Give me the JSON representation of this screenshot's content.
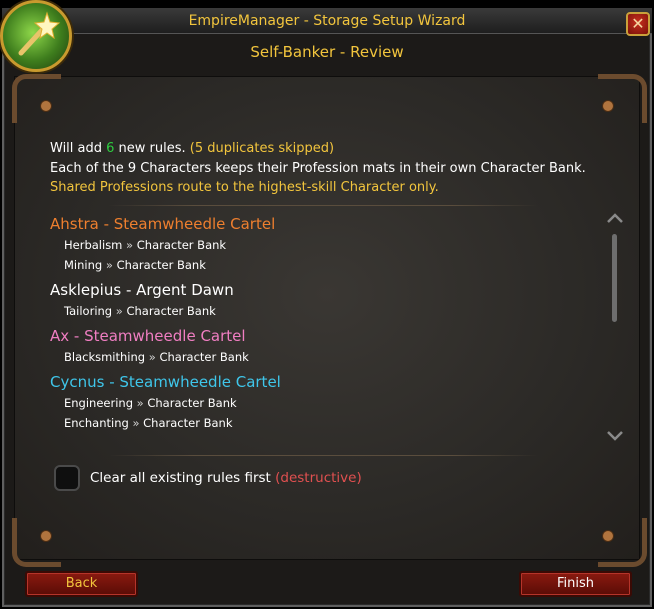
{
  "window": {
    "title": "EmpireManager - Storage Setup Wizard",
    "subtitle": "Self-Banker - Review",
    "close_glyph": "✕"
  },
  "summary": {
    "line1_prefix": "Will add ",
    "count": "6",
    "line1_mid": " new rules. ",
    "duplicates": "(5 duplicates skipped)",
    "line2": "Each of the 9 Characters keeps their Profession mats in their own Character Bank.",
    "line3": "Shared Professions route to the highest-skill Character only."
  },
  "characters": [
    {
      "name": "Ahstra - Steamwheedle Cartel",
      "color": "#ee7f2e",
      "rules": [
        {
          "prof": "Herbalism",
          "dest": "Character Bank"
        },
        {
          "prof": "Mining",
          "dest": "Character Bank"
        }
      ]
    },
    {
      "name": "Asklepius - Argent Dawn",
      "color": "#ffffff",
      "rules": [
        {
          "prof": "Tailoring",
          "dest": "Character Bank"
        }
      ]
    },
    {
      "name": "Ax - Steamwheedle Cartel",
      "color": "#f07ec2",
      "rules": [
        {
          "prof": "Blacksmithing",
          "dest": "Character Bank"
        }
      ]
    },
    {
      "name": "Cycnus - Steamwheedle Cartel",
      "color": "#3fc6ea",
      "rules": [
        {
          "prof": "Engineering",
          "dest": "Character Bank"
        },
        {
          "prof": "Enchanting",
          "dest": "Character Bank"
        }
      ]
    }
  ],
  "rule_separator": "»",
  "options": {
    "clear_label": "Clear all existing rules first ",
    "clear_warning": "(destructive)",
    "clear_checked": false
  },
  "buttons": {
    "back": "Back",
    "finish": "Finish"
  },
  "icons": {
    "logo": "magic-wand-icon",
    "close": "close-icon",
    "scroll_up": "chevron-up-icon",
    "scroll_down": "chevron-down-icon"
  }
}
